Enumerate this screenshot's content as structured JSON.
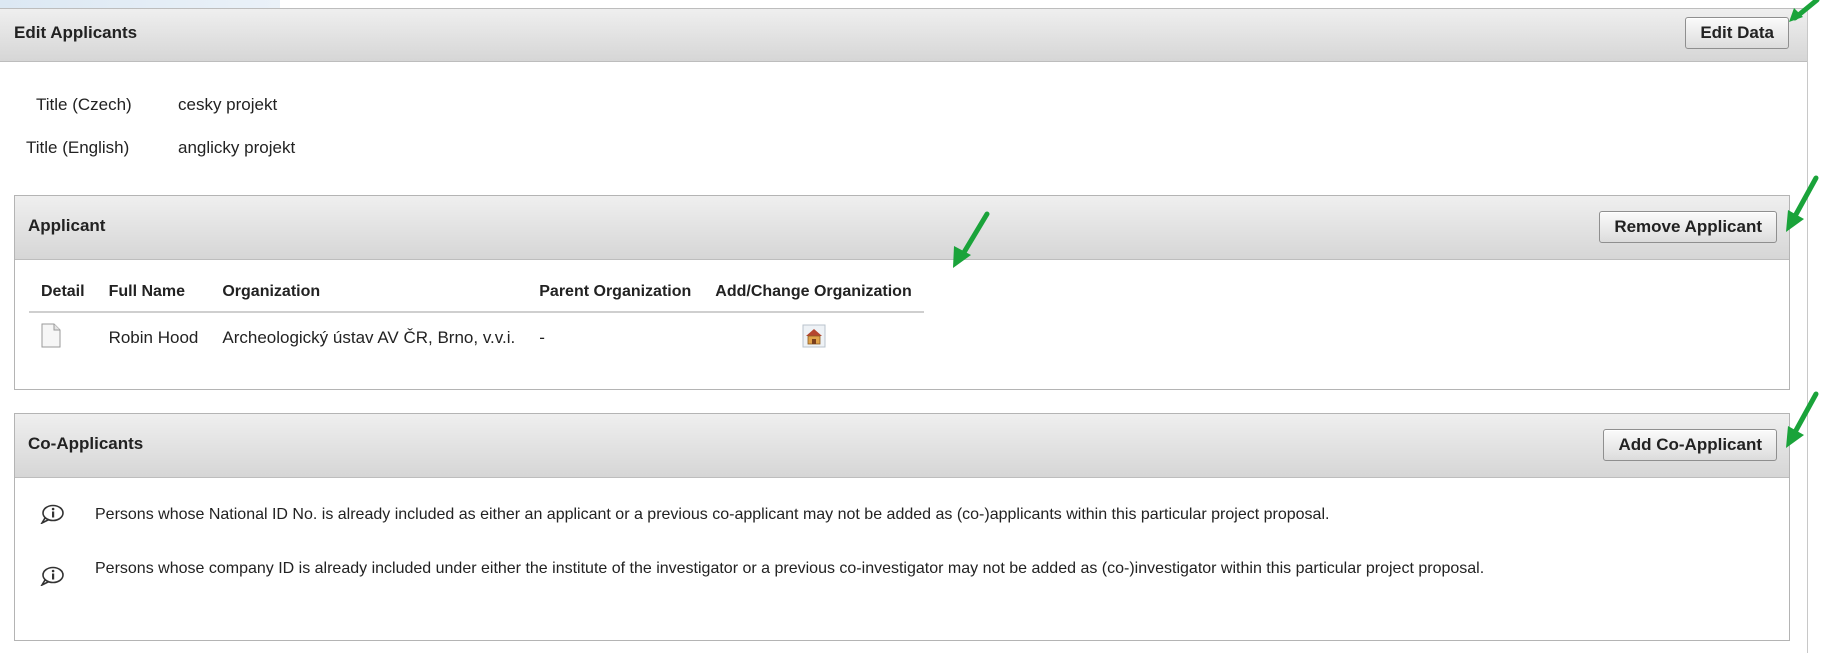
{
  "page": {
    "title": "Edit Applicants",
    "edit_button": "Edit Data"
  },
  "fields": [
    {
      "label": "Title (Czech)",
      "value": "cesky projekt"
    },
    {
      "label": "Title (English)",
      "value": "anglicky projekt"
    }
  ],
  "applicant": {
    "title": "Applicant",
    "remove_button": "Remove Applicant",
    "columns": [
      "Detail",
      "Full Name",
      "Organization",
      "Parent Organization",
      "Add/Change Organization"
    ],
    "rows": [
      {
        "full_name": "Robin Hood",
        "organization": "Archeologický ústav AV ČR, Brno, v.v.i.",
        "parent_organization": "-"
      }
    ]
  },
  "coapplicants": {
    "title": "Co-Applicants",
    "add_button": "Add Co-Applicant",
    "notes": [
      "Persons whose National ID No. is already included as either an applicant or a previous co-applicant may not be added as (co-)applicants within this particular project proposal.",
      "Persons whose company ID is already included under either the institute of the investigator or a previous co-investigator may not be added as (co-)investigator within this particular project proposal."
    ]
  },
  "colors": {
    "annotation_arrow": "#1aa33a",
    "header_bar": "#d6d6d6"
  },
  "icons": [
    "document-icon",
    "organization-house-icon",
    "info-icon",
    "annotation-arrow"
  ]
}
